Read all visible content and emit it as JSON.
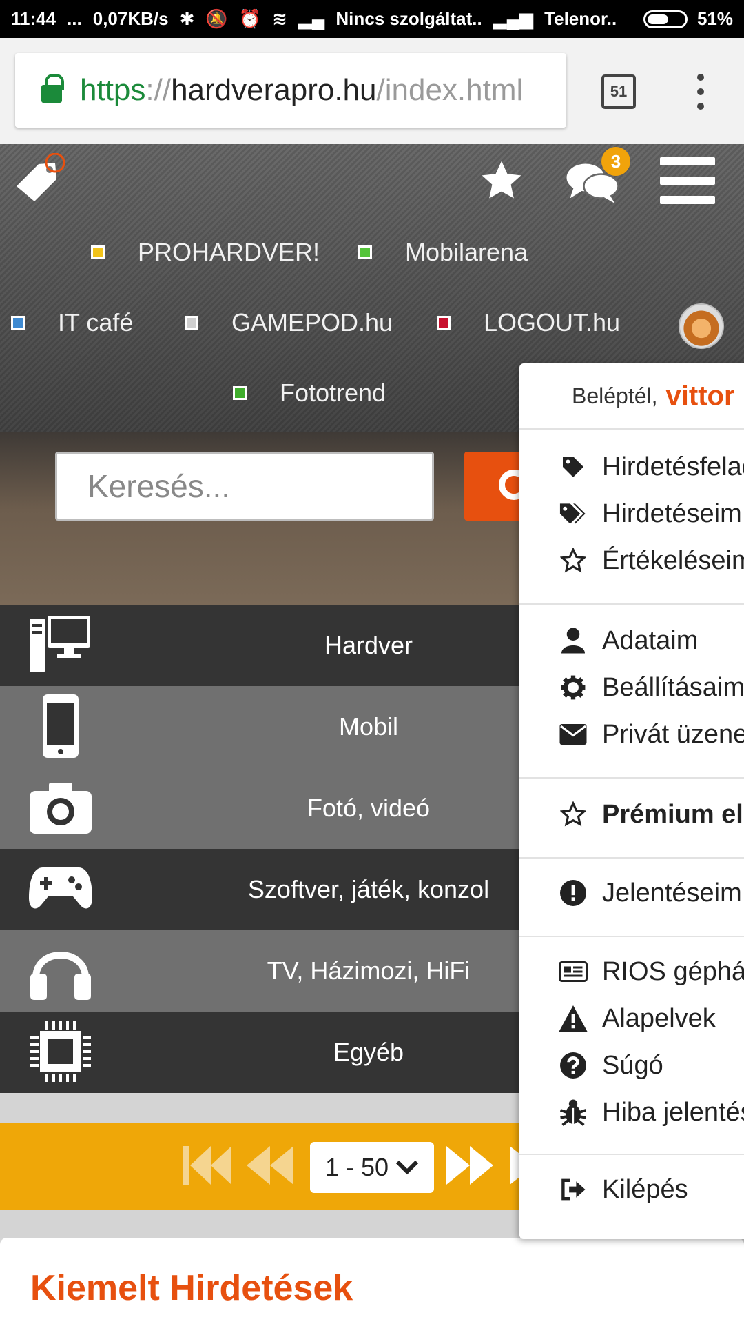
{
  "status_bar": {
    "time": "11:44",
    "dots": "...",
    "speed": "0,07KB/s",
    "carrier1": "Nincs szolgáltat..",
    "carrier2": "Telenor..",
    "battery": "51%",
    "battery_level": 0.51
  },
  "browser": {
    "url_scheme": "https",
    "url_sep": "://",
    "url_host": "hardverapro.hu",
    "url_path": "/index.html",
    "tab_count": "51"
  },
  "header": {
    "notification_count": "3",
    "site_links": [
      {
        "label": "PROHARDVER!",
        "color": "#f2c319"
      },
      {
        "label": "Mobilarena",
        "color": "#55c43a"
      },
      {
        "label": "IT café",
        "color": "#3f8ad1"
      },
      {
        "label": "GAMEPOD.hu",
        "color": "#cfcfcf"
      },
      {
        "label": "LOGOUT.hu",
        "color": "#c8102e"
      },
      {
        "label": "Fototrend",
        "color": "#3fad2c"
      }
    ]
  },
  "search": {
    "placeholder": "Keresés..."
  },
  "categories": [
    {
      "label": "Hardver",
      "icon": "desktop-computer-icon"
    },
    {
      "label": "Mobil",
      "icon": "mobile-phone-icon"
    },
    {
      "label": "Fotó, videó",
      "icon": "camera-icon"
    },
    {
      "label": "Szoftver, játék, konzol",
      "icon": "gamepad-icon"
    },
    {
      "label": "TV, Házimozi, HiFi",
      "icon": "headphones-icon"
    },
    {
      "label": "Egyéb",
      "icon": "chip-icon"
    }
  ],
  "pagination": {
    "range": "1 - 50"
  },
  "featured": {
    "title": "Kiemelt Hirdetések"
  },
  "user_menu": {
    "greeting": "Beléptél,",
    "username": "vittor",
    "items": [
      {
        "label": "Hirdetésfelad",
        "icon": "tag-icon"
      },
      {
        "label": "Hirdetéseim",
        "icon": "tags-icon"
      },
      {
        "label": "Értékeléseim",
        "icon": "star-outline-icon"
      },
      {
        "label": "Adataim",
        "icon": "user-icon"
      },
      {
        "label": "Beállításaim",
        "icon": "gear-icon"
      },
      {
        "label": "Privát üzenet",
        "icon": "envelope-icon"
      },
      {
        "label": "Prémium elő",
        "icon": "star-outline-icon"
      },
      {
        "label": "Jelentéseim",
        "icon": "exclamation-icon"
      },
      {
        "label": "RIOS gépház",
        "icon": "newspaper-icon"
      },
      {
        "label": "Alapelvek",
        "icon": "warning-icon"
      },
      {
        "label": "Súgó",
        "icon": "question-icon"
      },
      {
        "label": "Hiba jelentés",
        "icon": "bug-icon"
      },
      {
        "label": "Kilépés",
        "icon": "sign-out-icon"
      }
    ]
  }
}
